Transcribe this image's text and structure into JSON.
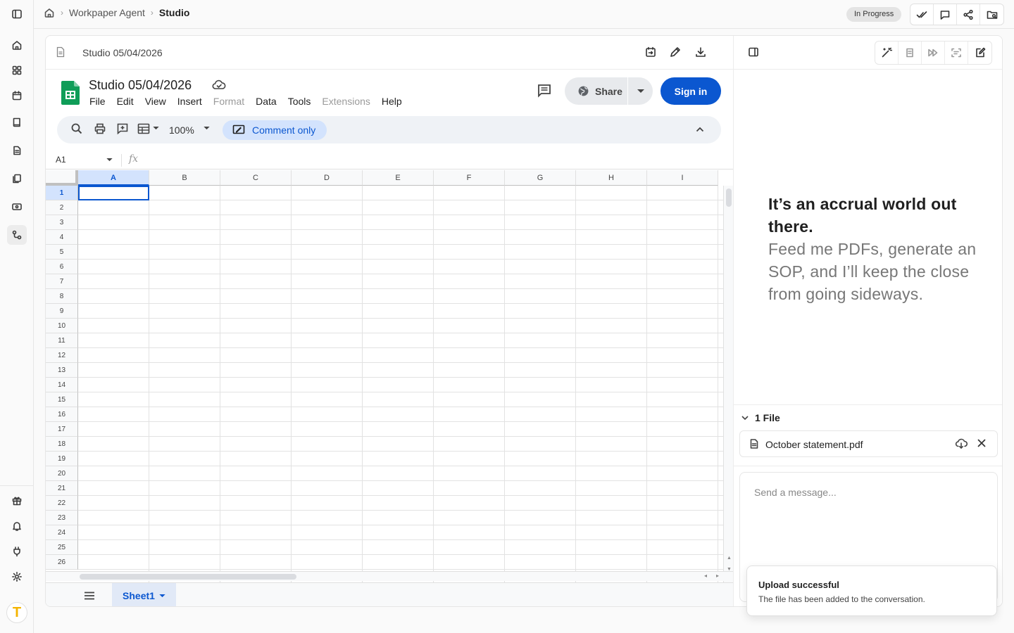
{
  "breadcrumb": {
    "parent": "Workpaper Agent",
    "current": "Studio"
  },
  "status": "In Progress",
  "document": {
    "title": "Studio 05/04/2026"
  },
  "spreadsheet": {
    "title": "Studio 05/04/2026",
    "menu": [
      "File",
      "Edit",
      "View",
      "Insert",
      "Format",
      "Data",
      "Tools",
      "Extensions",
      "Help"
    ],
    "share_label": "Share",
    "signin_label": "Sign in",
    "zoom": "100%",
    "mode_label": "Comment only",
    "name_box": "A1",
    "fx_label": "fx",
    "columns": [
      "A",
      "B",
      "C",
      "D",
      "E",
      "F",
      "G",
      "H",
      "I"
    ],
    "rows": [
      "1",
      "2",
      "3",
      "4",
      "5",
      "6",
      "7",
      "8",
      "9",
      "10",
      "11",
      "12",
      "13",
      "14",
      "15",
      "16",
      "17",
      "18",
      "19",
      "20",
      "21",
      "22",
      "23",
      "24",
      "25",
      "26"
    ],
    "selected_cell": "A1",
    "sheet_tab": "Sheet1"
  },
  "assistant": {
    "hero_heading": "It’s an accrual world out there.",
    "hero_sub": "Feed me PDFs, generate an SOP, and I’ll keep the close from going sideways.",
    "files_header": "1 File",
    "files": [
      {
        "name": "October statement.pdf"
      }
    ],
    "message_placeholder": "Send a message..."
  },
  "toast": {
    "title": "Upload successful",
    "description": "The file has been added to the conversation."
  },
  "colors": {
    "accent": "#0b57d0",
    "sheets_green": "#0f9d58",
    "logo_yellow": "#f4b400"
  }
}
